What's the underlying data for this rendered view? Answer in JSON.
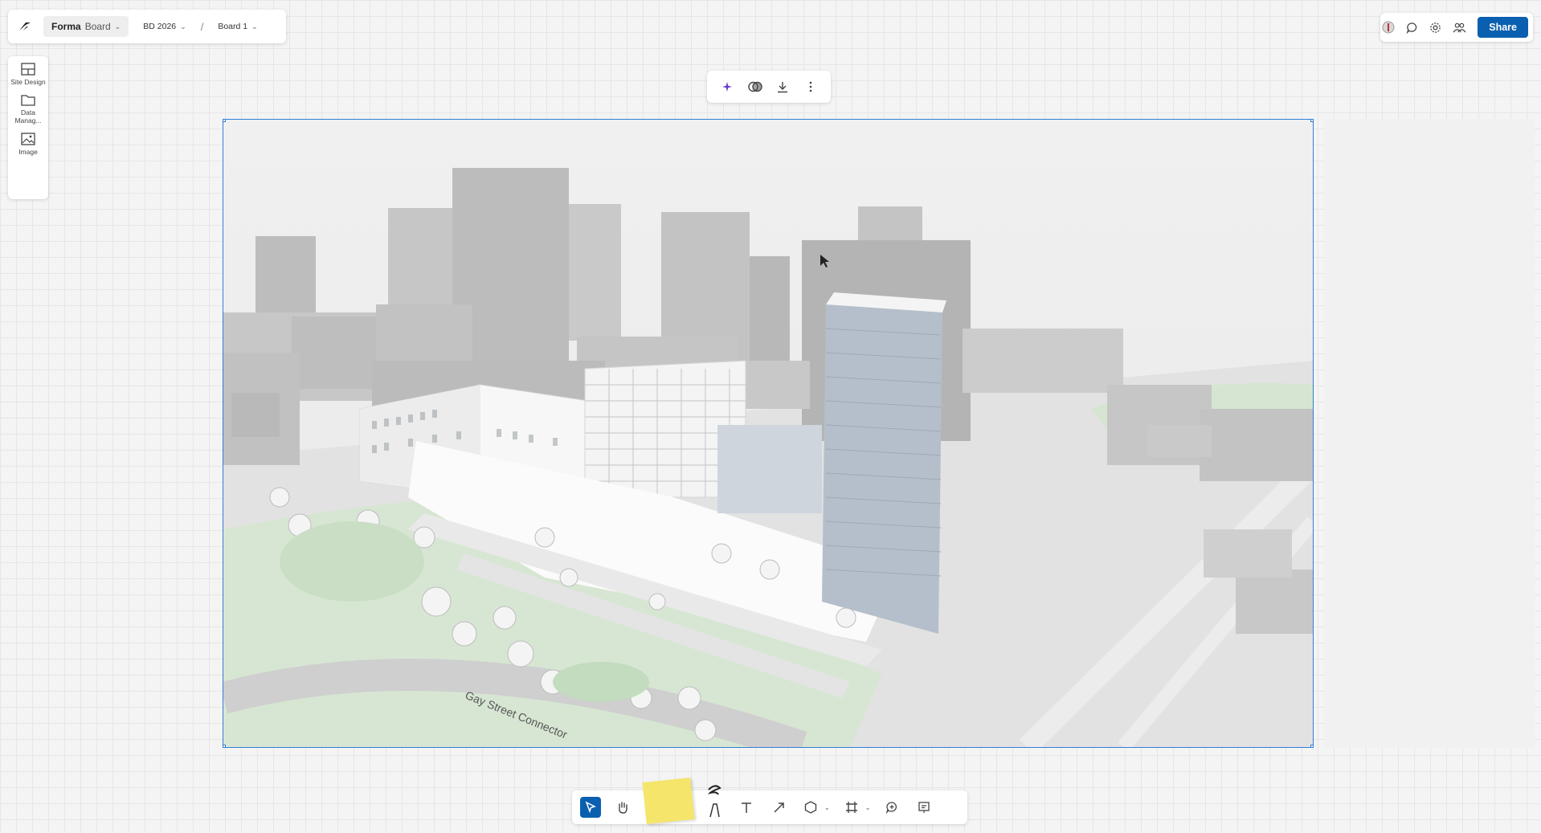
{
  "app": {
    "name_bold": "Forma",
    "name_light": "Board"
  },
  "breadcrumb": {
    "project": "BD 2026",
    "separator": "/",
    "board": "Board 1"
  },
  "header": {
    "share_label": "Share"
  },
  "left_tools": [
    {
      "label": "Site Design",
      "icon": "site-design-icon"
    },
    {
      "label": "Data Manag...",
      "icon": "folder-icon"
    },
    {
      "label": "Image",
      "icon": "image-icon"
    }
  ],
  "image_toolbar": [
    {
      "icon": "sparkle-icon",
      "color": "#6a3bd0"
    },
    {
      "icon": "compare-icon"
    },
    {
      "icon": "download-icon"
    },
    {
      "icon": "more-vertical-icon"
    }
  ],
  "canvas_image": {
    "street_label": "Gay Street Connector"
  },
  "bottom_tools": [
    "select-icon",
    "hand-icon",
    "sticky-note",
    "pen-icon",
    "text-icon",
    "arrow-icon",
    "shape-icon",
    "frame-icon",
    "comment-icon",
    "present-icon"
  ],
  "colors": {
    "accent": "#0a5fb0",
    "selection": "#2d7fd6",
    "sticky": "#f5e56b"
  }
}
